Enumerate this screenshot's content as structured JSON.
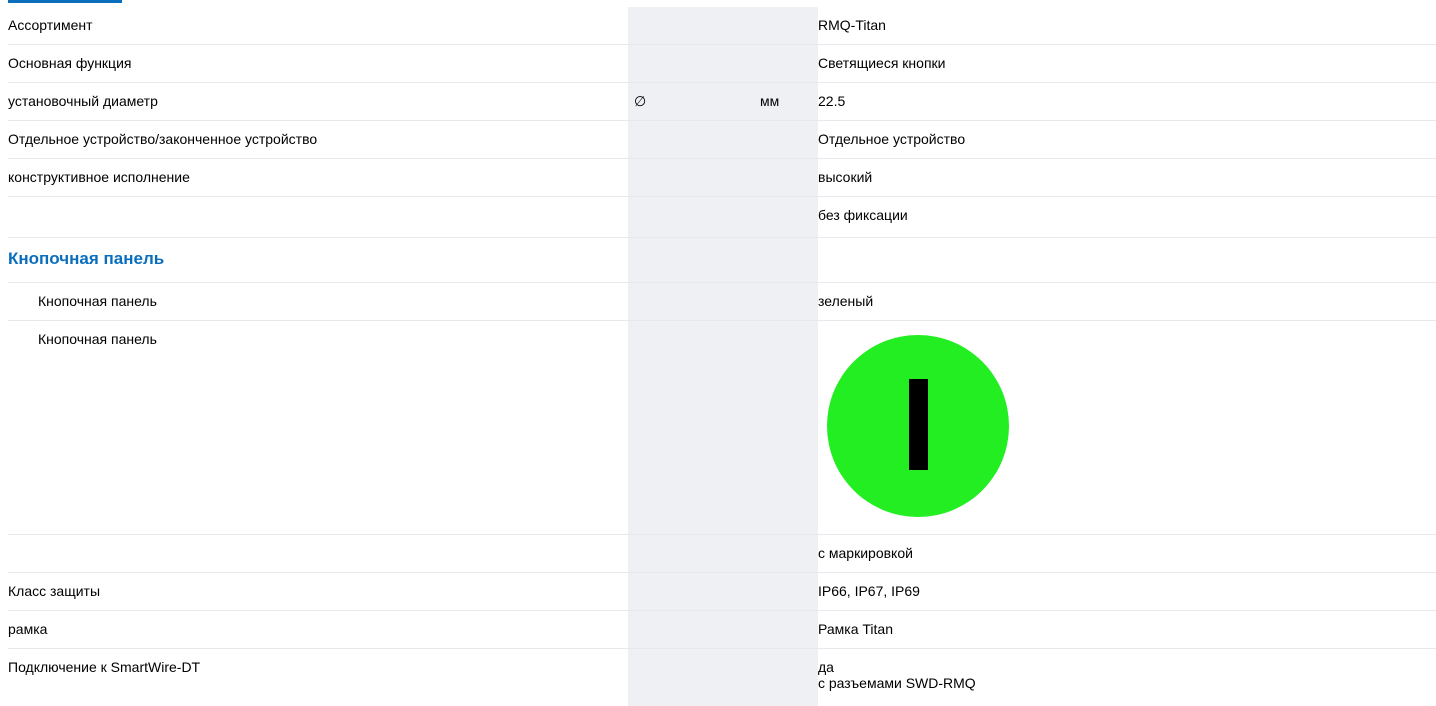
{
  "rows": [
    {
      "label": "Ассортимент",
      "value": "RMQ-Titan"
    },
    {
      "label": "Основная функция",
      "value": "Светящиеся кнопки"
    },
    {
      "label": "установочный диаметр",
      "symbol": "∅",
      "unit": "мм",
      "value": "22.5"
    },
    {
      "label": "Отдельное устройство/законченное устройство",
      "value": "Отдельное устройство"
    },
    {
      "label": "конструктивное исполнение",
      "value": "высокий"
    },
    {
      "label": "",
      "value": "без фиксации"
    }
  ],
  "section": {
    "title": "Кнопочная панель",
    "rows": [
      {
        "label": "Кнопочная панель",
        "value": "зеленый"
      },
      {
        "label": "Кнопочная панель",
        "image": {
          "fill_color": "#22ee22",
          "mark_color": "#000000",
          "icon": "button-face-marking-I-icon"
        }
      },
      {
        "label": "",
        "value": "с маркировкой"
      }
    ]
  },
  "rows_after": [
    {
      "label": "Класс защиты",
      "value": "IP66, IP67, IP69"
    },
    {
      "label": "рамка",
      "value": "Рамка Titan"
    },
    {
      "label": "Подключение к SmartWire-DT",
      "value_lines": [
        "да",
        "с разъемами SWD-RMQ"
      ]
    }
  ],
  "colors": {
    "section_title": "#0a6ebd",
    "shaded_column": "#eef0f4",
    "row_divider": "#e6e8ec"
  }
}
